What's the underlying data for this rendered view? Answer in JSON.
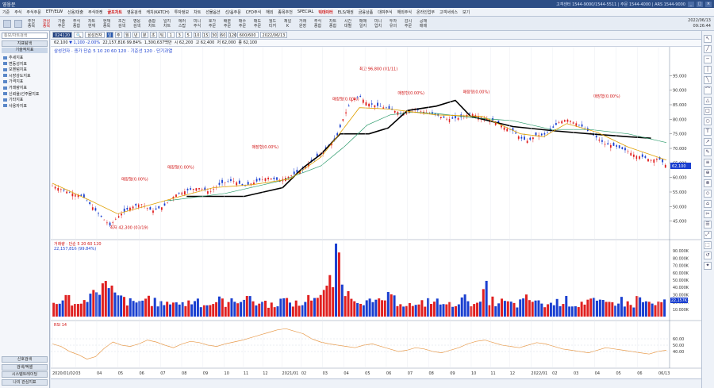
{
  "window": {
    "title": "영웅문",
    "info": "고객센터 1544-9000/1544-5511  |  주문 1544-4000  |  ARS 1544-9000",
    "buttons": [
      "_",
      "□",
      "×"
    ]
  },
  "menu": [
    {
      "label": "기준",
      "hot": false
    },
    {
      "label": "주식",
      "hot": false
    },
    {
      "label": "주식주문",
      "hot": false
    },
    {
      "label": "ETF/ELW",
      "hot": false
    },
    {
      "label": "신용/대출",
      "hot": false
    },
    {
      "label": "주식마켓",
      "hot": false
    },
    {
      "label": "골프차트",
      "hot": true
    },
    {
      "label": "영웅검색",
      "hot": false
    },
    {
      "label": "캐치(KATCH)",
      "hot": false
    },
    {
      "label": "투자정보",
      "hot": false
    },
    {
      "label": "차트",
      "hot": false
    },
    {
      "label": "선물옵션",
      "hot": false
    },
    {
      "label": "선/옵주문",
      "hot": false
    },
    {
      "label": "CFD주식",
      "hot": false
    },
    {
      "label": "해외",
      "hot": false
    },
    {
      "label": "종목추천",
      "hot": false
    },
    {
      "label": "SPECIAL",
      "hot": false
    },
    {
      "label": "빅데이터",
      "hot": true
    },
    {
      "label": "ELS/채권",
      "hot": false
    },
    {
      "label": "금융상품",
      "hot": false
    },
    {
      "label": "대여주식",
      "hot": false
    },
    {
      "label": "해외주식",
      "hot": false
    },
    {
      "label": "온라인업무",
      "hot": false
    },
    {
      "label": "고객서비스",
      "hot": false
    },
    {
      "label": "보기",
      "hot": false
    }
  ],
  "toolbar": {
    "buttons": [
      {
        "label": "추천\n종목",
        "hot": false
      },
      {
        "label": "관심\n종목",
        "hot": true
      },
      {
        "label": "기술\n주문",
        "hot": false
      },
      {
        "label": "주식\n종합",
        "hot": false
      },
      {
        "label": "차트\n현재",
        "hot": false
      },
      {
        "label": "현재\n종목",
        "hot": false
      },
      {
        "label": "조건\n검색",
        "hot": false
      },
      {
        "label": "영웅\n검색",
        "hot": false
      },
      {
        "label": "종합\n차트",
        "hot": false
      },
      {
        "label": "일지\n차트",
        "hot": false
      },
      {
        "label": "에러\n스탑",
        "hot": false
      },
      {
        "label": "미니\n주식",
        "hot": false
      },
      {
        "label": "호가\n주문",
        "hot": false
      },
      {
        "label": "배분\n주문",
        "hot": false
      },
      {
        "label": "매수\n주문",
        "hot": false
      },
      {
        "label": "매도\n주문",
        "hot": false
      },
      {
        "label": "월드\n티커",
        "hot": false
      },
      {
        "label": "채널\nK",
        "hot": false
      },
      {
        "label": "거래\n원장",
        "hot": false
      },
      {
        "label": "주식\n종합",
        "hot": false
      },
      {
        "label": "차트\n종합",
        "hot": false
      },
      {
        "label": "시간\n대별",
        "hot": false
      },
      {
        "label": "매매\n일지",
        "hot": false
      },
      {
        "label": "미니\n업치",
        "hot": false
      },
      {
        "label": "투자\n유의",
        "hot": false
      },
      {
        "label": "감시\n주문",
        "hot": false
      },
      {
        "label": "공채\n매매",
        "hot": false
      }
    ],
    "clock": "2022/06/13",
    "time": "09:26:44"
  },
  "sidebar": {
    "search_placeholder": "통보/차트검색",
    "tab": "지표탐색",
    "subheader": "기술적지표",
    "items": [
      "추세지표",
      "변동성지표",
      "모멘텀지표",
      "시장강도지표",
      "가격지표",
      "거래량지표",
      "신뢰율/선주물지표",
      "기타지표",
      "사용자지표"
    ],
    "bottom": [
      "신호검색",
      "검색/엑셀",
      "시스템트레이딩",
      "나의 관심지표"
    ]
  },
  "chart_toolbar": {
    "code": "024120",
    "name": "삼성전자",
    "periods": [
      "일",
      "주",
      "월",
      "년",
      "분",
      "초",
      "틱"
    ],
    "selected_period": "일",
    "intervals": [
      "1",
      "3",
      "5",
      "10",
      "15",
      "30",
      "60",
      "120"
    ],
    "count": "600/600",
    "date": "2022/06/13"
  },
  "quote": {
    "price": "62,100",
    "arrow": "▼",
    "change": "1,100",
    "pct": "-2.00%",
    "volume": "22,157,816",
    "vol_ratio": "99.84%",
    "amount": "1,300,637백만",
    "open_label": "시",
    "open": "62,200",
    "high_label": "고",
    "high": "62,400",
    "low_label": "저",
    "low": "62,000",
    "close_label": "종",
    "close": "62,100"
  },
  "chart_data": [
    {
      "type": "candlestick",
      "legend": "삼성전자 · 종가 단순 5 10 20 60 120 · 기준선 120 · 단기과열",
      "ylim": [
        40000,
        100000
      ],
      "yticks": [
        "95.000",
        "90.000",
        "85.000",
        "80.000",
        "75.000",
        "70.000",
        "65.000",
        "60.000",
        "55.000",
        "50.000",
        "45.000"
      ],
      "y_values": [
        95000,
        90000,
        85000,
        80000,
        75000,
        70000,
        65000,
        60000,
        55000,
        50000,
        45000
      ],
      "series": [
        {
          "name": "close",
          "points": [
            [
              0,
              57200
            ],
            [
              8,
              55000
            ],
            [
              16,
              53500
            ],
            [
              24,
              47500
            ],
            [
              30,
              43500
            ],
            [
              34,
              46500
            ],
            [
              40,
              49500
            ],
            [
              46,
              51000
            ],
            [
              52,
              48500
            ],
            [
              58,
              50000
            ],
            [
              64,
              54000
            ],
            [
              70,
              55500
            ],
            [
              76,
              56500
            ],
            [
              82,
              55000
            ],
            [
              88,
              58000
            ],
            [
              94,
              59000
            ],
            [
              100,
              57000
            ],
            [
              106,
              58500
            ],
            [
              112,
              60000
            ],
            [
              118,
              59000
            ],
            [
              124,
              60500
            ],
            [
              130,
              62500
            ],
            [
              136,
              66000
            ],
            [
              142,
              69500
            ],
            [
              148,
              73500
            ],
            [
              152,
              81000
            ],
            [
              156,
              86500
            ],
            [
              160,
              88000
            ],
            [
              164,
              85500
            ],
            [
              170,
              84500
            ],
            [
              176,
              83500
            ],
            [
              182,
              82000
            ],
            [
              188,
              83500
            ],
            [
              194,
              82500
            ],
            [
              200,
              81500
            ],
            [
              206,
              80000
            ],
            [
              212,
              80500
            ],
            [
              218,
              82000
            ],
            [
              224,
              80500
            ],
            [
              230,
              79500
            ],
            [
              236,
              77000
            ],
            [
              240,
              76000
            ],
            [
              244,
              73500
            ],
            [
              248,
              72500
            ],
            [
              252,
              74500
            ],
            [
              256,
              74500
            ],
            [
              260,
              76500
            ],
            [
              264,
              79000
            ],
            [
              268,
              80000
            ],
            [
              272,
              79000
            ],
            [
              276,
              77500
            ],
            [
              280,
              75500
            ],
            [
              284,
              73500
            ],
            [
              288,
              71500
            ],
            [
              292,
              71000
            ],
            [
              296,
              70000
            ],
            [
              300,
              69000
            ],
            [
              304,
              67500
            ],
            [
              308,
              67000
            ],
            [
              312,
              66000
            ],
            [
              316,
              66500
            ],
            [
              320,
              64000
            ]
          ]
        },
        {
          "name": "ma120",
          "points": [
            [
              70,
              53500
            ],
            [
              100,
              53500
            ],
            [
              110,
              55000
            ],
            [
              120,
              56500
            ],
            [
              130,
              63000
            ],
            [
              140,
              68000
            ],
            [
              150,
              75000
            ],
            [
              165,
              75000
            ],
            [
              175,
              77000
            ],
            [
              185,
              83000
            ],
            [
              200,
              84500
            ],
            [
              210,
              86500
            ],
            [
              218,
              81000
            ],
            [
              240,
              77500
            ],
            [
              262,
              76000
            ],
            [
              280,
              75000
            ],
            [
              300,
              74000
            ],
            [
              312,
              73500
            ]
          ]
        },
        {
          "name": "ma60",
          "points": [
            [
              60,
              52000
            ],
            [
              90,
              54500
            ],
            [
              120,
              59000
            ],
            [
              140,
              64000
            ],
            [
              152,
              70500
            ],
            [
              164,
              78000
            ],
            [
              176,
              81500
            ],
            [
              188,
              82500
            ],
            [
              200,
              82000
            ],
            [
              220,
              80500
            ],
            [
              240,
              79500
            ],
            [
              260,
              76500
            ],
            [
              280,
              76500
            ],
            [
              300,
              75000
            ],
            [
              320,
              72000
            ]
          ]
        },
        {
          "name": "ma20",
          "points": [
            [
              0,
              58000
            ],
            [
              20,
              52000
            ],
            [
              34,
              47500
            ],
            [
              48,
              50000
            ],
            [
              64,
              53000
            ],
            [
              84,
              56500
            ],
            [
              104,
              57500
            ],
            [
              124,
              59500
            ],
            [
              140,
              67000
            ],
            [
              152,
              77000
            ],
            [
              160,
              84000
            ],
            [
              176,
              83500
            ],
            [
              200,
              81500
            ],
            [
              224,
              81000
            ],
            [
              244,
              75000
            ],
            [
              256,
              74000
            ],
            [
              268,
              78500
            ],
            [
              284,
              75500
            ],
            [
              300,
              70500
            ],
            [
              320,
              66000
            ]
          ]
        }
      ],
      "annotations": [
        {
          "label": "최고 96,800 (01/11)",
          "x": 160,
          "y": 96800
        },
        {
          "label": "최저 42,300 (03/19)",
          "x": 30,
          "y": 42300
        },
        {
          "label": "매장형(0.00%)",
          "x": 36,
          "y": 59000
        },
        {
          "label": "매장형(0.00%)",
          "x": 60,
          "y": 63000
        },
        {
          "label": "매장형(0.00%)",
          "x": 104,
          "y": 70000
        },
        {
          "label": "매장형(0.00%)",
          "x": 146,
          "y": 86500
        },
        {
          "label": "매장형(0.00%)",
          "x": 180,
          "y": 88500
        },
        {
          "label": "매장형(0.00%)",
          "x": 214,
          "y": 89000
        },
        {
          "label": "매장형(0.00%)",
          "x": 282,
          "y": 87500
        }
      ],
      "price_tag": "62,100"
    },
    {
      "type": "bar",
      "legend": "거래량 · 단순 5 20 60 120",
      "legend2": "22,157,816 (99.84%)",
      "ylim": [
        0,
        100
      ],
      "yticks": [
        "90.000K",
        "80.000K",
        "70.000K",
        "60.000K",
        "50.000K",
        "40.000K",
        "30.000K",
        "20.000K",
        "10.000K"
      ],
      "y_values": [
        90,
        80,
        70,
        60,
        50,
        40,
        30,
        20,
        10
      ],
      "values": [
        18,
        22,
        25,
        20,
        16,
        28,
        30,
        38,
        42,
        35,
        28,
        24,
        20,
        18,
        22,
        25,
        20,
        18,
        16,
        22,
        19,
        17,
        20,
        23,
        18,
        16,
        20,
        22,
        18,
        20,
        24,
        28,
        22,
        18,
        20,
        16,
        18,
        22,
        20,
        18,
        16,
        24,
        28,
        30,
        35,
        48,
        90,
        40,
        30,
        25,
        22,
        20,
        18,
        22,
        26,
        24,
        20,
        18,
        16,
        14,
        18,
        22,
        20,
        18,
        16,
        18,
        22,
        24,
        20,
        16,
        38,
        22,
        18,
        20,
        18,
        16,
        20,
        24,
        22,
        18,
        16,
        18,
        20,
        22,
        18,
        16,
        20,
        22,
        20,
        18,
        18,
        20,
        22,
        18,
        16,
        24,
        20,
        18,
        16,
        20
      ],
      "vol_tag": "22,157K"
    },
    {
      "type": "line",
      "legend": "RSI 14",
      "ylim": [
        20,
        80
      ],
      "yticks": [
        "60.00",
        "50.00",
        "40.00"
      ],
      "y_values": [
        60,
        50,
        40
      ],
      "values": [
        52,
        48,
        40,
        35,
        28,
        32,
        45,
        55,
        50,
        48,
        52,
        58,
        55,
        50,
        46,
        52,
        56,
        54,
        50,
        48,
        52,
        55,
        58,
        62,
        66,
        70,
        74,
        76,
        72,
        68,
        60,
        55,
        52,
        50,
        48,
        46,
        50,
        52,
        48,
        44,
        40,
        42,
        46,
        44,
        40,
        38,
        42,
        46,
        52,
        56,
        58,
        54,
        50,
        48,
        46,
        50,
        54,
        52,
        48,
        44,
        42,
        40,
        38,
        42,
        46,
        44,
        42,
        40,
        38,
        36,
        40,
        42
      ]
    }
  ],
  "x_axis": {
    "labels": [
      "2020/01/02",
      "03",
      "04",
      "05",
      "06",
      "07",
      "08",
      "09",
      "10",
      "11",
      "12",
      "2021/01",
      "02",
      "03",
      "04",
      "05",
      "06",
      "07",
      "08",
      "09",
      "10",
      "11",
      "12",
      "2022/01",
      "02",
      "03",
      "04",
      "05",
      "06",
      "06/13"
    ],
    "positions": [
      0,
      24,
      46,
      68,
      90,
      112,
      134,
      156,
      178,
      198,
      218,
      238,
      258,
      280,
      302,
      324,
      346,
      368,
      390,
      412,
      434,
      454,
      474,
      496,
      518,
      540,
      562,
      584,
      606,
      628
    ]
  },
  "colors": {
    "up": "#e02020",
    "down": "#1a3fd0",
    "ma5": "#c8a000",
    "ma20": "#e0a000",
    "ma60": "#2a9a6a",
    "ma120": "#000000",
    "rsi": "#e89a4a"
  }
}
